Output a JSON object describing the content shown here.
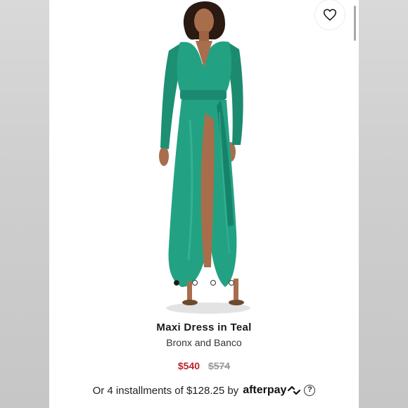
{
  "product": {
    "title": "Maxi Dress in Teal",
    "brand": "Bronx and Banco",
    "sale_price": "$540",
    "original_price": "$574"
  },
  "payment": {
    "installments_text": "Or 4 installments of $128.25 by",
    "provider": "afterpay",
    "help_symbol": "?"
  },
  "gallery": {
    "image_icon": "teal-maxi-dress-photo",
    "dots": [
      {
        "active": true
      },
      {
        "active": false
      },
      {
        "active": false
      },
      {
        "active": false
      }
    ]
  },
  "icons": {
    "wishlist": "heart-icon",
    "afterpay_logo": "afterpay-arrows-icon"
  },
  "colors": {
    "dress": "#1f9a7c",
    "sale_price": "#b8252b",
    "original_price": "#9a9a9a"
  }
}
